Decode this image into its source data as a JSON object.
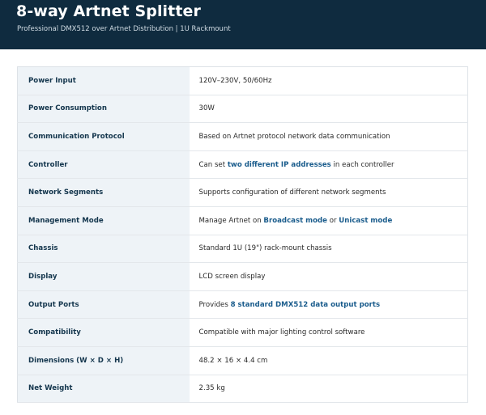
{
  "header": {
    "title": "8-way Artnet Splitter",
    "subtitle": "Professional DMX512 over Artnet Distribution | 1U Rackmount"
  },
  "colors": {
    "header_bg": "#0f2b3f",
    "label_bg": "#eef3f7",
    "highlight": "#1a5c8c"
  },
  "specs": [
    {
      "label": "Power Input",
      "value": [
        {
          "t": "120V–230V, 50/60Hz"
        }
      ]
    },
    {
      "label": "Power Consumption",
      "value": [
        {
          "t": "30W"
        }
      ]
    },
    {
      "label": "Communication Protocol",
      "value": [
        {
          "t": "Based on Artnet protocol network data communication"
        }
      ]
    },
    {
      "label": "Controller",
      "value": [
        {
          "t": "Can set "
        },
        {
          "t": "two different IP addresses",
          "hl": true
        },
        {
          "t": " in each controller"
        }
      ]
    },
    {
      "label": "Network Segments",
      "value": [
        {
          "t": "Supports configuration of different network segments"
        }
      ]
    },
    {
      "label": "Management Mode",
      "value": [
        {
          "t": "Manage Artnet on "
        },
        {
          "t": "Broadcast mode",
          "hl": true
        },
        {
          "t": " or "
        },
        {
          "t": "Unicast mode",
          "hl": true
        }
      ]
    },
    {
      "label": "Chassis",
      "value": [
        {
          "t": "Standard 1U (19\") rack-mount chassis"
        }
      ]
    },
    {
      "label": "Display",
      "value": [
        {
          "t": "LCD screen display"
        }
      ]
    },
    {
      "label": "Output Ports",
      "value": [
        {
          "t": "Provides "
        },
        {
          "t": "8 standard DMX512 data output ports",
          "hl": true
        }
      ]
    },
    {
      "label": "Compatibility",
      "value": [
        {
          "t": "Compatible with major lighting control software"
        }
      ]
    },
    {
      "label": "Dimensions (W × D × H)",
      "value": [
        {
          "t": "48.2 × 16 × 4.4 cm"
        }
      ]
    },
    {
      "label": "Net Weight",
      "value": [
        {
          "t": "2.35 kg"
        }
      ]
    }
  ]
}
